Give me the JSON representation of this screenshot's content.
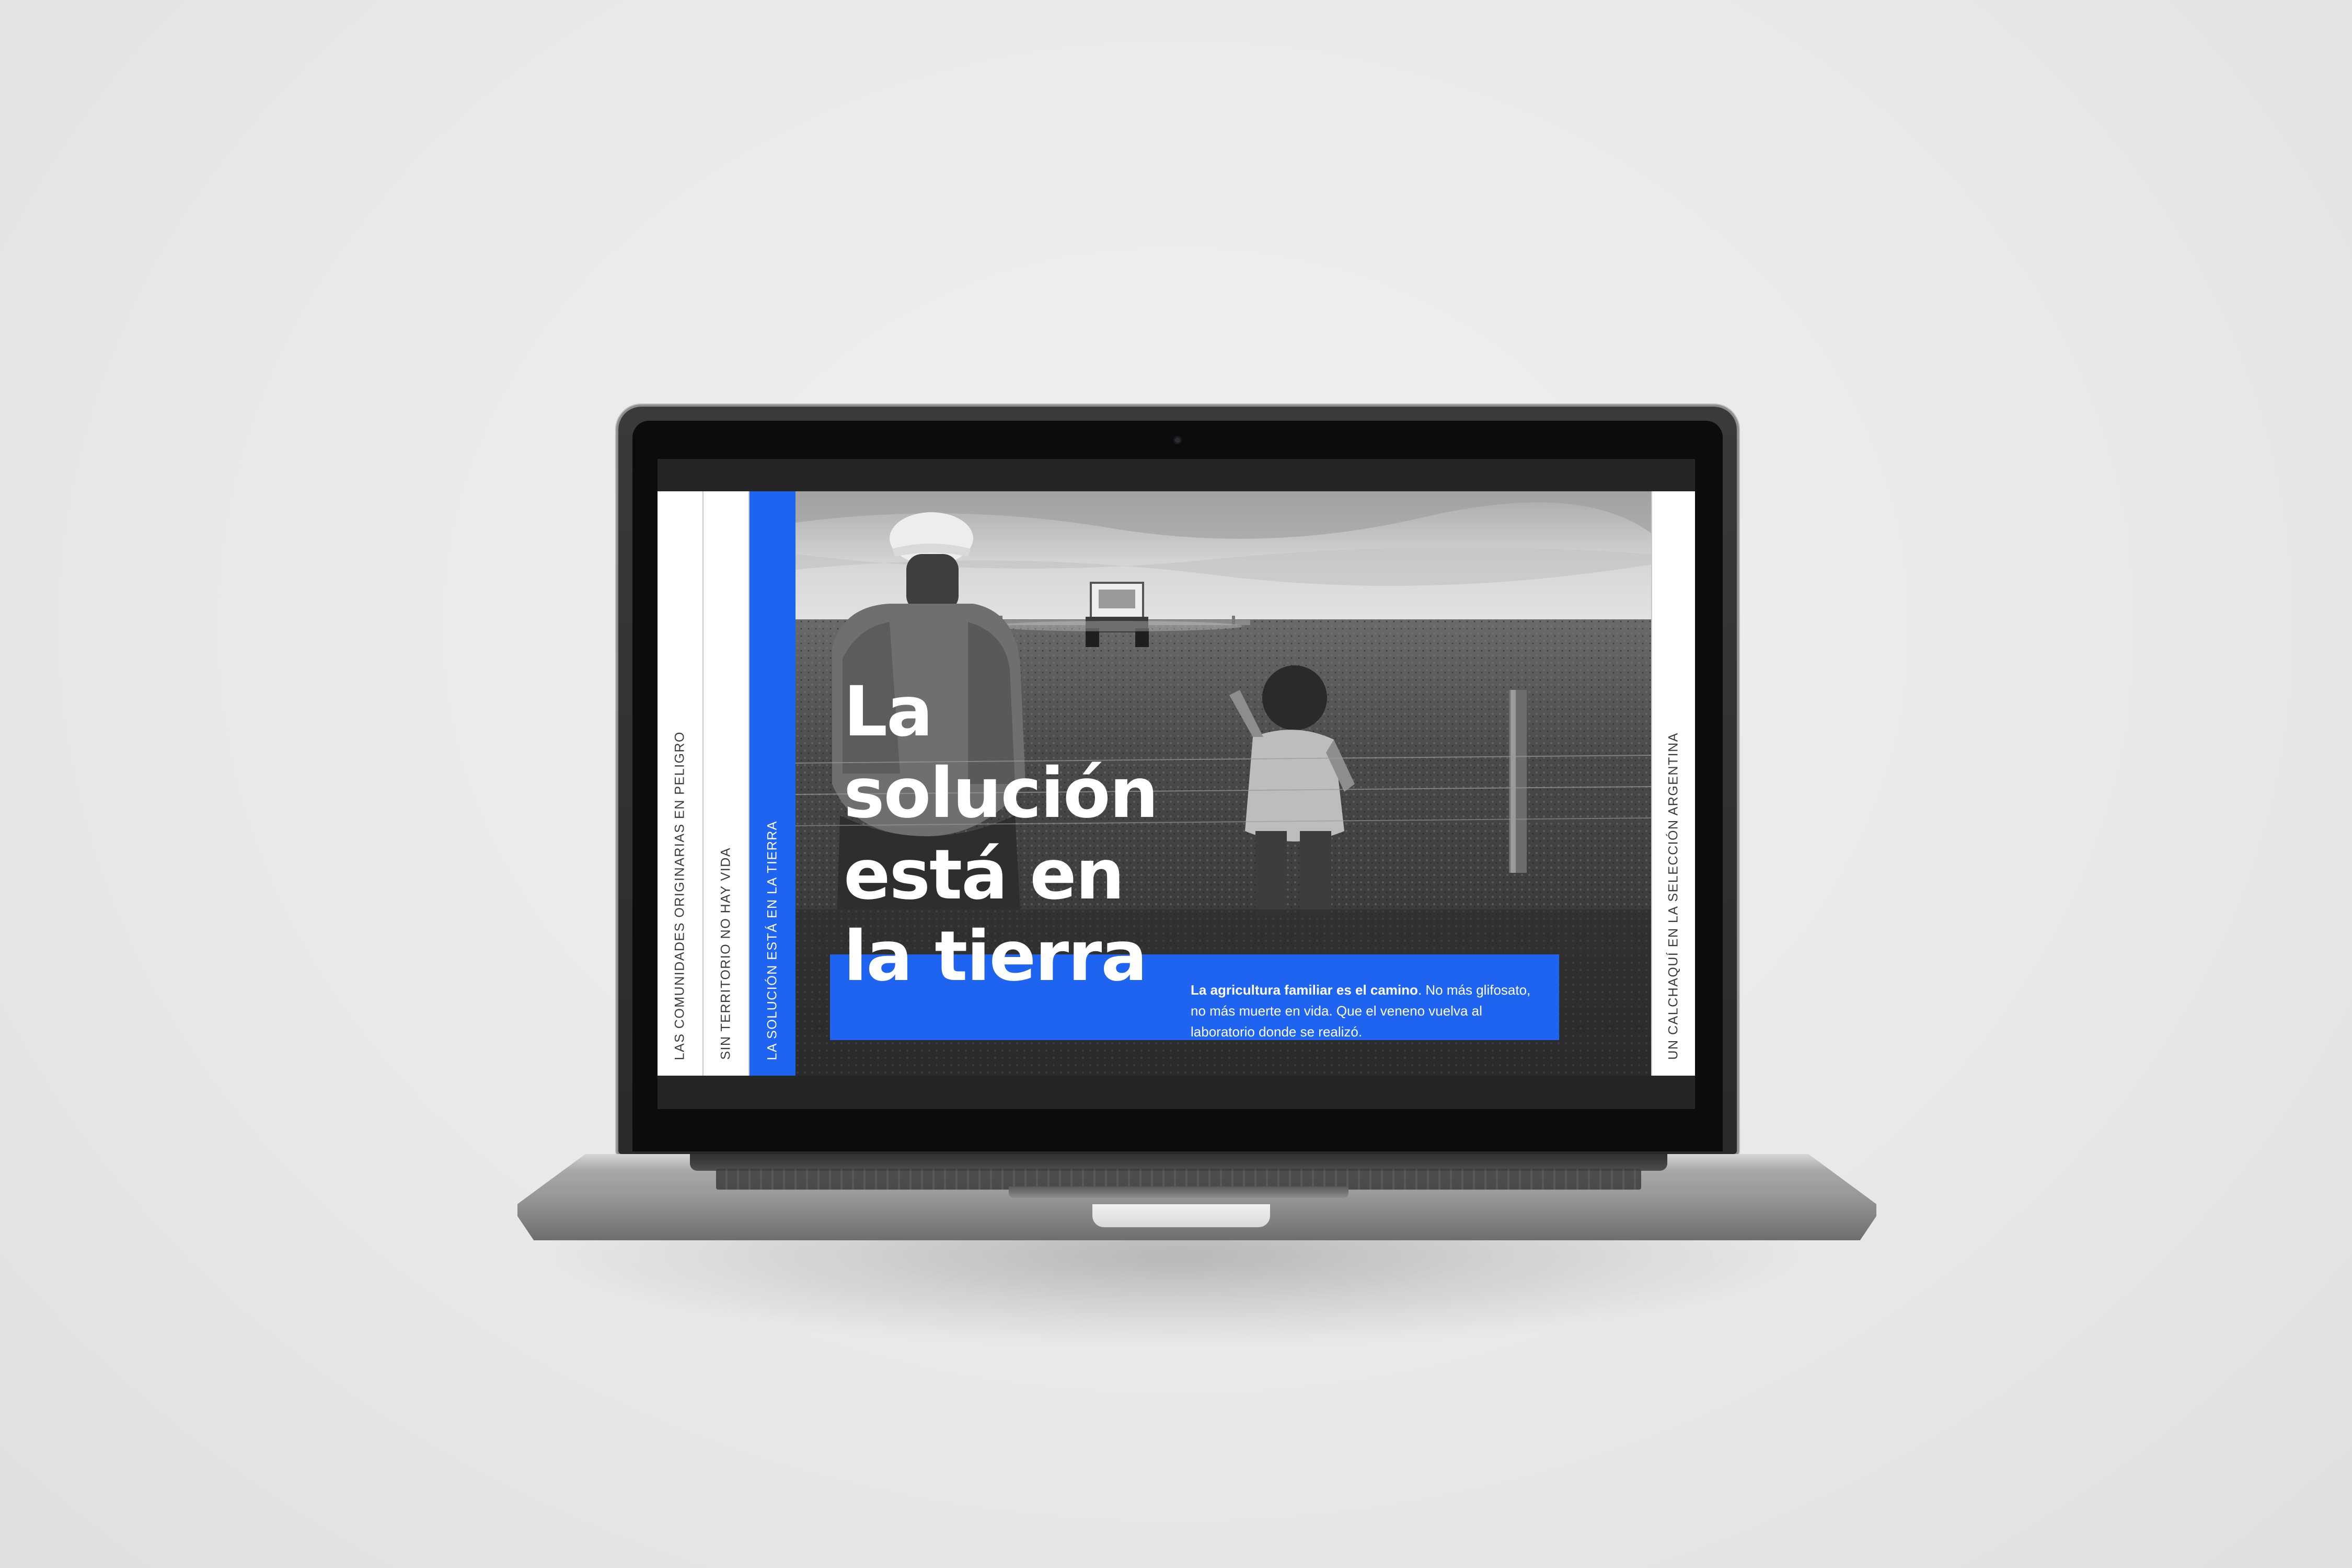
{
  "website": {
    "side_columns": [
      "LAS  COMUNIDADES  ORIGINARIAS EN PELIGRO",
      "SIN TERRITORIO NO HAY VIDA",
      "LA SOLUCIÓN ESTÁ EN LA TIERRA"
    ],
    "right_column": "UN CALCHAQUÍ EN LA SELECCIÓN ARGENTINA",
    "hero": {
      "headline_lines": [
        "La",
        "solución",
        "está en",
        "la tierra"
      ],
      "blurb_bold": "La agricultura familiar es el camino",
      "blurb_rest": ". No más glifosato, no más muerte en vida. Que el veneno vuelva al laboratorio donde se realizó."
    },
    "accent_color": "#1f64f1"
  }
}
